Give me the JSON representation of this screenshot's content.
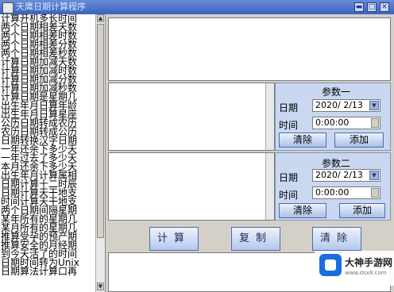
{
  "window": {
    "title": "天鹰日期计算程序",
    "minimize_glyph": "▬",
    "maximize_glyph": "□",
    "close_glyph": "✕"
  },
  "sidebar": {
    "items": [
      "计算开机多长时间",
      "两个日期相差天数",
      "两个日期相差时数",
      "两个日期相差分数",
      "两个日期相差秒数",
      "计算日期加减天数",
      "计算日期加减时数",
      "计算日期加减分数",
      "计算日期加减秒数",
      "计算日期是星期几",
      "出生年月日算年龄",
      "出生年月日算星座",
      "公历日期转成农历",
      "农历日期转成公历",
      "日期转换汉字日期",
      "一年还余下多少天",
      "一年过去了多少天",
      "本月还余下多少天",
      "出生年月计算属相",
      "日期计算十二时辰",
      "日期计算天干地支",
      "时间计算天干地支",
      "两个日期间隔星期",
      "某年所有的星期几",
      "某月所有的星期几",
      "推算受孕的预产期",
      "推算安全的月经期",
      "到今天活了的时间",
      "日期时间转为Unix",
      "日期算法计算口再"
    ]
  },
  "param1": {
    "title": "参数一",
    "date_label": "日期",
    "date_value": "2020/ 2/13",
    "time_label": "时间",
    "time_value": "0:00:00",
    "clear_button": "清除",
    "add_button": "添加"
  },
  "param2": {
    "title": "参数二",
    "date_label": "日期",
    "date_value": "2020/ 2/13",
    "time_label": "时间",
    "time_value": "0:00:00",
    "clear_button": "清除",
    "add_button": "添加"
  },
  "actions": {
    "calculate": "计算",
    "copy": "复制",
    "clear": "清除"
  },
  "watermark": {
    "name": "大神手游网",
    "url": "www.dsx8.com"
  },
  "colors": {
    "title_bar": "#3a62bf",
    "group_bg": "#c9d8f0",
    "button_border": "#4e6ca8"
  }
}
